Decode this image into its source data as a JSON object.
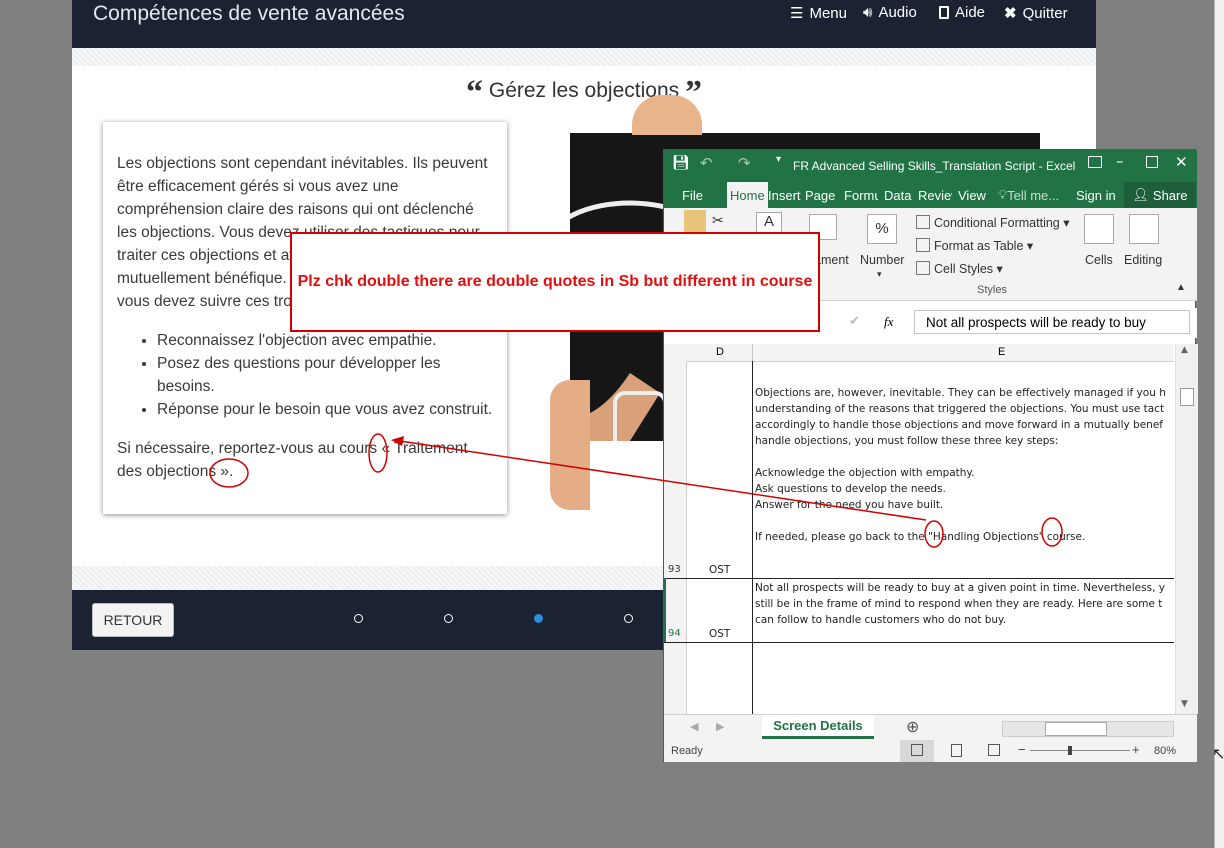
{
  "course": {
    "title": "Compétences de vente avancées",
    "nav": {
      "menu": "Menu",
      "audio": "Audio",
      "help": "Aide",
      "quit": "Quitter"
    },
    "slide_title": "Gérez les objections",
    "quote_open": "“",
    "quote_close": "”",
    "paragraph": "Les objections sont cependant inévitables. Ils peuvent être efficacement gérés si vous avez une compréhension claire des raisons qui ont déclenché les objections. Vous devez utiliser des tactiques pour traiter ces objections et avancer vers un résultat mutuellement bénéfique. Pour gérer les objections, vous devez suivre ces trois étapes clés :",
    "bullets": [
      "Reconnaissez l'objection avec empathie.",
      "Posez des questions pour développer les besoins.",
      "Réponse pour le besoin que vous avez construit."
    ],
    "footer_text": "Si nécessaire, reportez-vous au cours « Traitement des objections ».",
    "back_button": "RETOUR"
  },
  "excel": {
    "title": "FR Advanced Selling Skills_Translation Script - Excel",
    "tabs": [
      "File",
      "Home",
      "Insert",
      "Page",
      "Formu",
      "Data",
      "Review",
      "View"
    ],
    "tell_me": "Tell me...",
    "sign_in": "Sign in",
    "share": "Share",
    "ribbon": {
      "alignment": "ament",
      "number": "Number",
      "percent": "%",
      "conditional_formatting": "Conditional Formatting",
      "format_as_table": "Format as Table",
      "cell_styles": "Cell Styles",
      "styles_group": "Styles",
      "cells": "Cells",
      "editing": "Editing"
    },
    "formula_bar": "Not all prospects will be ready to buy",
    "fx": "fx",
    "columns": [
      "D",
      "E"
    ],
    "rows": [
      {
        "num": "93",
        "d": "OST",
        "e_lines": [
          "Objections are, however, inevitable. They can be effectively managed if you h",
          "understanding of the reasons that triggered the objections. You must use tact",
          "accordingly to handle those objections and move forward in a mutually benef",
          "handle objections, you must follow these three key steps:",
          "",
          "Acknowledge the objection with empathy.",
          "Ask questions to develop the needs.",
          "Answer for the need you have built.",
          "",
          "If needed, please go back to the \"Handling Objections\" course."
        ]
      },
      {
        "num": "94",
        "d": "OST",
        "e_lines": [
          "Not all prospects will be ready to buy at a given point in time. Nevertheless, y",
          "still be in the frame of mind to respond when they are ready. Here are some t",
          "can follow to handle customers who do not buy."
        ]
      }
    ],
    "sheet_tab": "Screen Details",
    "status": "Ready",
    "zoom": "80%"
  },
  "callout": "Plz chk double there are double quotes in Sb but different in course",
  "colors": {
    "excel_green": "#217346",
    "course_dark": "#1b2232",
    "annotation_red": "#d40000"
  }
}
